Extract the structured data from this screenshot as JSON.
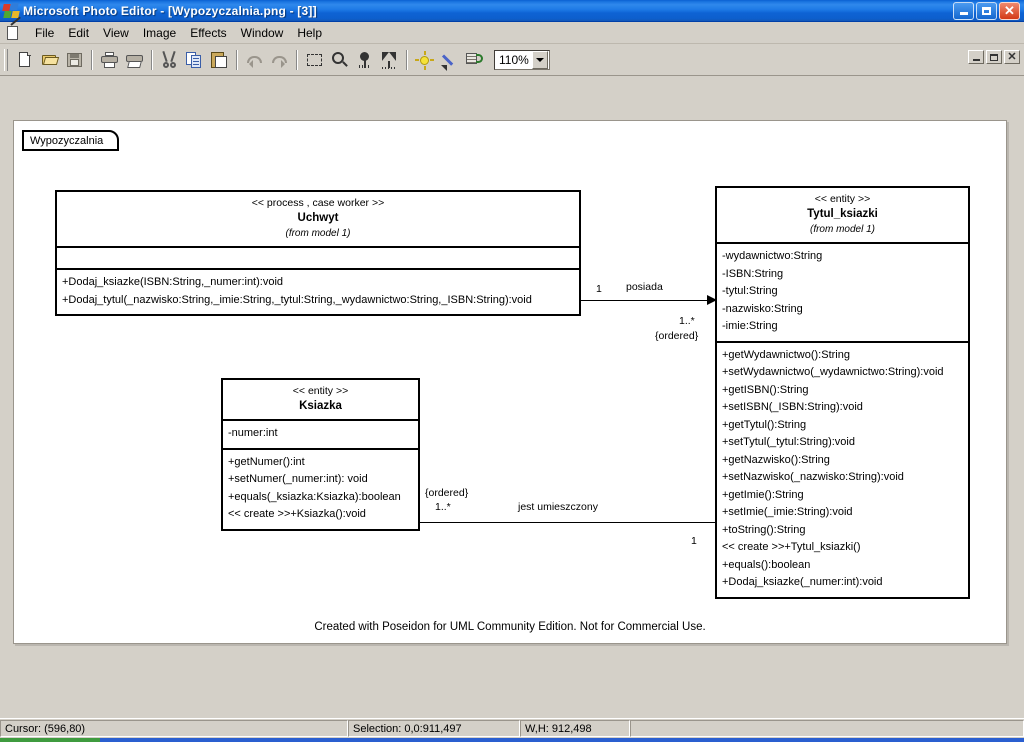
{
  "window": {
    "app_name": "Microsoft Photo Editor",
    "title": "Microsoft Photo Editor  - [Wypozyczalnia.png - [3]]",
    "icon": "photo-editor-icon",
    "buttons": {
      "minimize": "minimize-icon",
      "maximize": "restore-icon",
      "close": "close-icon"
    }
  },
  "menubar": {
    "doc_icon": "document-edit-icon",
    "items": [
      {
        "label": "File"
      },
      {
        "label": "Edit"
      },
      {
        "label": "View"
      },
      {
        "label": "Image"
      },
      {
        "label": "Effects"
      },
      {
        "label": "Window"
      },
      {
        "label": "Help"
      }
    ]
  },
  "toolbar": {
    "buttons": [
      {
        "name": "new-icon",
        "tip": "New"
      },
      {
        "name": "open-icon",
        "tip": "Open"
      },
      {
        "name": "save-icon",
        "tip": "Save"
      },
      {
        "name": "print-icon",
        "tip": "Print"
      },
      {
        "name": "print-preview-icon",
        "tip": "Print Preview"
      },
      {
        "name": "cut-icon",
        "tip": "Cut"
      },
      {
        "name": "copy-icon",
        "tip": "Copy"
      },
      {
        "name": "paste-icon",
        "tip": "Paste"
      },
      {
        "name": "undo-icon",
        "tip": "Undo"
      },
      {
        "name": "redo-icon",
        "tip": "Redo"
      },
      {
        "name": "select-icon",
        "tip": "Select"
      },
      {
        "name": "zoom-icon",
        "tip": "Zoom"
      },
      {
        "name": "stamp-icon",
        "tip": "Stamp"
      },
      {
        "name": "funnel-icon",
        "tip": "Effects"
      },
      {
        "name": "brightness-icon",
        "tip": "Brightness"
      },
      {
        "name": "pencil-icon",
        "tip": "Draw"
      },
      {
        "name": "properties-icon",
        "tip": "Image Properties"
      }
    ],
    "zoom": {
      "value": "110%",
      "chevron": "chevron-down-icon"
    }
  },
  "mdi": {
    "buttons": {
      "minimize": "minimize-icon",
      "restore": "restore-icon",
      "close": "close-icon"
    }
  },
  "diagram": {
    "package_label": "Wypozyczalnia",
    "footer": "Created with Poseidon for UML Community Edition. Not for Commercial Use.",
    "classes": [
      {
        "id": "uchwyt",
        "stereotype": "<< process , case worker >>",
        "name": "Uchwyt",
        "from": "(from model 1)",
        "attributes": [],
        "operations": [
          "+Dodaj_ksiazke(ISBN:String,_numer:int):void",
          "+Dodaj_tytul(_nazwisko:String,_imie:String,_tytul:String,_wydawnictwo:String,_ISBN:String):void"
        ]
      },
      {
        "id": "ksiazka",
        "stereotype": "<< entity >>",
        "name": "Ksiazka",
        "from": "",
        "attributes": [
          "-numer:int"
        ],
        "operations": [
          "+getNumer():int",
          "+setNumer(_numer:int): void",
          "+equals(_ksiazka:Ksiazka):boolean",
          "<< create >>+Ksiazka():void"
        ]
      },
      {
        "id": "tytul_ksiazki",
        "stereotype": "<< entity >>",
        "name": "Tytul_ksiazki",
        "from": "(from model 1)",
        "attributes": [
          "-wydawnictwo:String",
          "-ISBN:String",
          "-tytul:String",
          "-nazwisko:String",
          "-imie:String"
        ],
        "operations": [
          "+getWydawnictwo():String",
          "+setWydawnictwo(_wydawnictwo:String):void",
          "+getISBN():String",
          "+setISBN(_ISBN:String):void",
          "+getTytul():String",
          "+setTytul(_tytul:String):void",
          "+getNazwisko():String",
          "+setNazwisko(_nazwisko:String):void",
          "+getImie():String",
          "+setImie(_imie:String):void",
          "+toString():String",
          "<< create >>+Tytul_ksiazki()",
          "+equals():boolean",
          "+Dodaj_ksiazke(_numer:int):void"
        ]
      }
    ],
    "associations": [
      {
        "id": "posiada",
        "name": "posiada",
        "source_mult": "1",
        "target_mult": "1..*",
        "target_constraint": "{ordered}"
      },
      {
        "id": "jest-umieszczony",
        "name": "jest umieszczony",
        "source_mult": "1..*",
        "source_constraint": "{ordered}",
        "target_mult": "1"
      }
    ]
  },
  "statusbar": {
    "cursor": "Cursor: (596,80)",
    "selection": "Selection: 0,0:911,497",
    "dimensions": "W,H: 912,498"
  }
}
